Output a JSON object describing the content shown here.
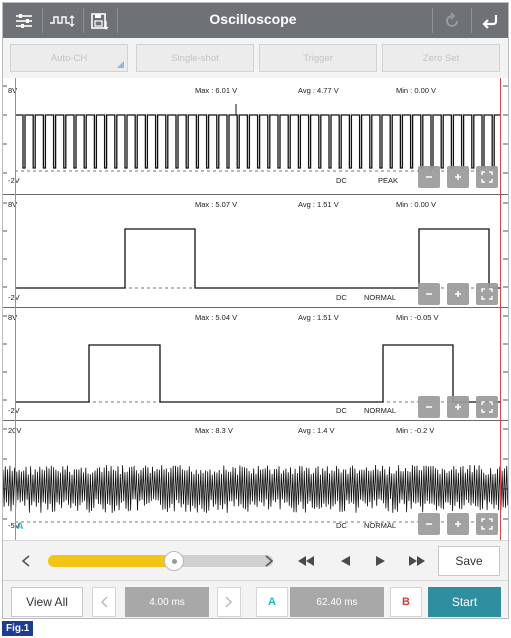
{
  "header": {
    "title": "Oscilloscope",
    "icons": [
      "sliders-icon",
      "waveform-icon",
      "save-file-icon",
      "refresh-icon",
      "back-arrow-icon"
    ]
  },
  "modes": {
    "auto_ch": "Auto-CH",
    "single_shot": "Single-shot",
    "trigger": "Trigger",
    "zero_set": "Zero Set"
  },
  "channels": [
    {
      "top_label": "8V",
      "bottom_label": "-2V",
      "max": "Max : 6.01 V",
      "avg": "Avg : 4.77 V",
      "min": "Min : 0.00 V",
      "coupling": "DC",
      "mode": "PEAK",
      "pattern": "pulses"
    },
    {
      "top_label": "8V",
      "bottom_label": "-2V",
      "max": "Max : 5.07 V",
      "avg": "Avg : 1.51 V",
      "min": "Min : 0.00 V",
      "coupling": "DC",
      "mode": "NORMAL",
      "pattern": "square-a"
    },
    {
      "top_label": "8V",
      "bottom_label": "-2V",
      "max": "Max : 5.04 V",
      "avg": "Avg : 1.51 V",
      "min": "Min : -0.05 V",
      "coupling": "DC",
      "mode": "NORMAL",
      "pattern": "square-b"
    },
    {
      "top_label": "20V",
      "bottom_label": "-5V",
      "max": "Max : 8.3 V",
      "avg": "Avg : 1.4 V",
      "min": "Min : -0.2 V",
      "coupling": "DC",
      "mode": "NORMAL",
      "pattern": "noise"
    }
  ],
  "cursors": {
    "a_label": "A"
  },
  "playback": {
    "slider_position": 0.56,
    "save_label": "Save"
  },
  "bottom": {
    "view_all": "View All",
    "time_div": "4.00 ms",
    "marker_a": "A",
    "cursor_time": "62.40 ms",
    "marker_b": "B",
    "start": "Start"
  },
  "colors": {
    "header": "#6e7276",
    "cursor_a": "#39b6c8",
    "cursor_b": "#d94848",
    "slider": "#f2c515",
    "start": "#2f8fa0",
    "fig_label": "#1d3d8c"
  },
  "figure_label": "Fig.1"
}
